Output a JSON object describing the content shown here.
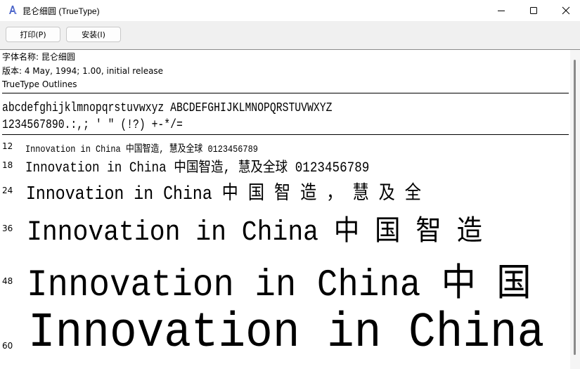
{
  "window": {
    "title": "昆仑细圆 (TrueType)",
    "icon": "font-file-icon"
  },
  "toolbar": {
    "print_label": "打印(P)",
    "install_label": "安装(I)"
  },
  "info": {
    "font_name": "字体名称: 昆仑细圆",
    "version": "版本: 4 May, 1994; 1.00, initial release",
    "outline_type": "TrueType Outlines"
  },
  "charset": {
    "line1": "abcdefghijklmnopqrstuvwxyz ABCDEFGHIJKLMNOPQRSTUVWXYZ",
    "line2": "1234567890.:,; ' \" (!?) +-*/="
  },
  "samples": [
    {
      "size": "12",
      "text": "Innovation in China 中国智造, 慧及全球 0123456789"
    },
    {
      "size": "18",
      "text": "Innovation in China 中国智造, 慧及全球 0123456789"
    },
    {
      "size": "24",
      "text": "Innovation in China 中 国 智 造 ， 慧 及 全"
    },
    {
      "size": "36",
      "text": "Innovation in China 中  国  智  造"
    },
    {
      "size": "48",
      "text": "Innovation in China 中  国"
    },
    {
      "size": "60",
      "text": "Innovation in China"
    }
  ],
  "colors": {
    "toolbar_bg": "#f0f0f0",
    "text": "#000000"
  }
}
